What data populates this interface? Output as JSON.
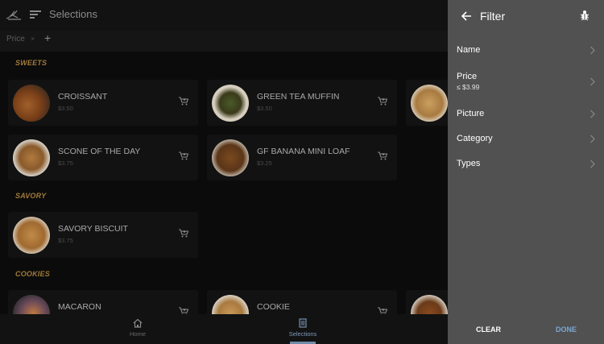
{
  "header": {
    "title": "Selections"
  },
  "chips": {
    "price_label": "Price",
    "remove": "×",
    "add": "+"
  },
  "sections": [
    {
      "title": "SWEETS",
      "items": [
        {
          "name": "CROISSANT",
          "price": "$3.50"
        },
        {
          "name": "GREEN TEA MUFFIN",
          "price": "$3.50"
        },
        {
          "name": "SCONE OF THE DAY",
          "price": "$3.75"
        },
        {
          "name": "GF BANANA MINI LOAF",
          "price": "$3.25"
        }
      ]
    },
    {
      "title": "SAVORY",
      "items": [
        {
          "name": "SAVORY BISCUIT",
          "price": "$3.75"
        }
      ]
    },
    {
      "title": "COOKIES",
      "items": [
        {
          "name": "MACARON",
          "price": ""
        },
        {
          "name": "COOKIE",
          "price": ""
        }
      ]
    }
  ],
  "bottom_nav": {
    "home": "Home",
    "selections": "Selections"
  },
  "filter": {
    "title": "Filter",
    "rows": [
      {
        "label": "Name",
        "sub": ""
      },
      {
        "label": "Price",
        "sub": "≤ $3.99"
      },
      {
        "label": "Picture",
        "sub": ""
      },
      {
        "label": "Category",
        "sub": ""
      },
      {
        "label": "Types",
        "sub": ""
      }
    ],
    "clear": "CLEAR",
    "done": "DONE"
  },
  "colors": {
    "accent": "#6e8ba8",
    "section": "#a07a3a",
    "panel": "#515151",
    "done": "#7aa7d6"
  }
}
